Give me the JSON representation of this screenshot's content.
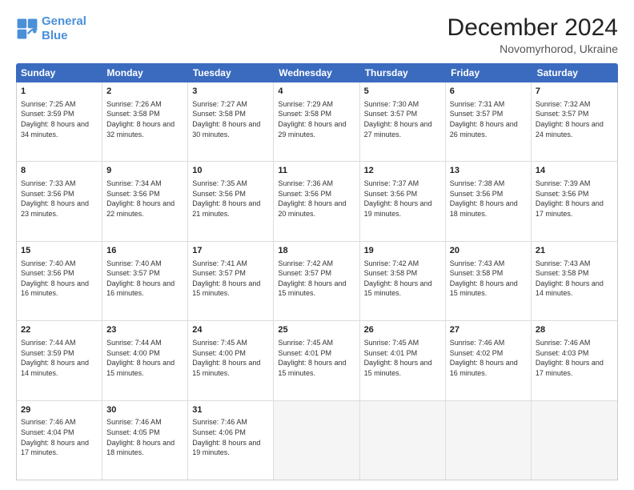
{
  "logo": {
    "line1": "General",
    "line2": "Blue"
  },
  "title": "December 2024",
  "location": "Novomyrhorod, Ukraine",
  "days": [
    "Sunday",
    "Monday",
    "Tuesday",
    "Wednesday",
    "Thursday",
    "Friday",
    "Saturday"
  ],
  "weeks": [
    [
      {
        "day": "1",
        "sunrise": "Sunrise: 7:25 AM",
        "sunset": "Sunset: 3:59 PM",
        "daylight": "Daylight: 8 hours and 34 minutes."
      },
      {
        "day": "2",
        "sunrise": "Sunrise: 7:26 AM",
        "sunset": "Sunset: 3:58 PM",
        "daylight": "Daylight: 8 hours and 32 minutes."
      },
      {
        "day": "3",
        "sunrise": "Sunrise: 7:27 AM",
        "sunset": "Sunset: 3:58 PM",
        "daylight": "Daylight: 8 hours and 30 minutes."
      },
      {
        "day": "4",
        "sunrise": "Sunrise: 7:29 AM",
        "sunset": "Sunset: 3:58 PM",
        "daylight": "Daylight: 8 hours and 29 minutes."
      },
      {
        "day": "5",
        "sunrise": "Sunrise: 7:30 AM",
        "sunset": "Sunset: 3:57 PM",
        "daylight": "Daylight: 8 hours and 27 minutes."
      },
      {
        "day": "6",
        "sunrise": "Sunrise: 7:31 AM",
        "sunset": "Sunset: 3:57 PM",
        "daylight": "Daylight: 8 hours and 26 minutes."
      },
      {
        "day": "7",
        "sunrise": "Sunrise: 7:32 AM",
        "sunset": "Sunset: 3:57 PM",
        "daylight": "Daylight: 8 hours and 24 minutes."
      }
    ],
    [
      {
        "day": "8",
        "sunrise": "Sunrise: 7:33 AM",
        "sunset": "Sunset: 3:56 PM",
        "daylight": "Daylight: 8 hours and 23 minutes."
      },
      {
        "day": "9",
        "sunrise": "Sunrise: 7:34 AM",
        "sunset": "Sunset: 3:56 PM",
        "daylight": "Daylight: 8 hours and 22 minutes."
      },
      {
        "day": "10",
        "sunrise": "Sunrise: 7:35 AM",
        "sunset": "Sunset: 3:56 PM",
        "daylight": "Daylight: 8 hours and 21 minutes."
      },
      {
        "day": "11",
        "sunrise": "Sunrise: 7:36 AM",
        "sunset": "Sunset: 3:56 PM",
        "daylight": "Daylight: 8 hours and 20 minutes."
      },
      {
        "day": "12",
        "sunrise": "Sunrise: 7:37 AM",
        "sunset": "Sunset: 3:56 PM",
        "daylight": "Daylight: 8 hours and 19 minutes."
      },
      {
        "day": "13",
        "sunrise": "Sunrise: 7:38 AM",
        "sunset": "Sunset: 3:56 PM",
        "daylight": "Daylight: 8 hours and 18 minutes."
      },
      {
        "day": "14",
        "sunrise": "Sunrise: 7:39 AM",
        "sunset": "Sunset: 3:56 PM",
        "daylight": "Daylight: 8 hours and 17 minutes."
      }
    ],
    [
      {
        "day": "15",
        "sunrise": "Sunrise: 7:40 AM",
        "sunset": "Sunset: 3:56 PM",
        "daylight": "Daylight: 8 hours and 16 minutes."
      },
      {
        "day": "16",
        "sunrise": "Sunrise: 7:40 AM",
        "sunset": "Sunset: 3:57 PM",
        "daylight": "Daylight: 8 hours and 16 minutes."
      },
      {
        "day": "17",
        "sunrise": "Sunrise: 7:41 AM",
        "sunset": "Sunset: 3:57 PM",
        "daylight": "Daylight: 8 hours and 15 minutes."
      },
      {
        "day": "18",
        "sunrise": "Sunrise: 7:42 AM",
        "sunset": "Sunset: 3:57 PM",
        "daylight": "Daylight: 8 hours and 15 minutes."
      },
      {
        "day": "19",
        "sunrise": "Sunrise: 7:42 AM",
        "sunset": "Sunset: 3:58 PM",
        "daylight": "Daylight: 8 hours and 15 minutes."
      },
      {
        "day": "20",
        "sunrise": "Sunrise: 7:43 AM",
        "sunset": "Sunset: 3:58 PM",
        "daylight": "Daylight: 8 hours and 15 minutes."
      },
      {
        "day": "21",
        "sunrise": "Sunrise: 7:43 AM",
        "sunset": "Sunset: 3:58 PM",
        "daylight": "Daylight: 8 hours and 14 minutes."
      }
    ],
    [
      {
        "day": "22",
        "sunrise": "Sunrise: 7:44 AM",
        "sunset": "Sunset: 3:59 PM",
        "daylight": "Daylight: 8 hours and 14 minutes."
      },
      {
        "day": "23",
        "sunrise": "Sunrise: 7:44 AM",
        "sunset": "Sunset: 4:00 PM",
        "daylight": "Daylight: 8 hours and 15 minutes."
      },
      {
        "day": "24",
        "sunrise": "Sunrise: 7:45 AM",
        "sunset": "Sunset: 4:00 PM",
        "daylight": "Daylight: 8 hours and 15 minutes."
      },
      {
        "day": "25",
        "sunrise": "Sunrise: 7:45 AM",
        "sunset": "Sunset: 4:01 PM",
        "daylight": "Daylight: 8 hours and 15 minutes."
      },
      {
        "day": "26",
        "sunrise": "Sunrise: 7:45 AM",
        "sunset": "Sunset: 4:01 PM",
        "daylight": "Daylight: 8 hours and 15 minutes."
      },
      {
        "day": "27",
        "sunrise": "Sunrise: 7:46 AM",
        "sunset": "Sunset: 4:02 PM",
        "daylight": "Daylight: 8 hours and 16 minutes."
      },
      {
        "day": "28",
        "sunrise": "Sunrise: 7:46 AM",
        "sunset": "Sunset: 4:03 PM",
        "daylight": "Daylight: 8 hours and 17 minutes."
      }
    ],
    [
      {
        "day": "29",
        "sunrise": "Sunrise: 7:46 AM",
        "sunset": "Sunset: 4:04 PM",
        "daylight": "Daylight: 8 hours and 17 minutes."
      },
      {
        "day": "30",
        "sunrise": "Sunrise: 7:46 AM",
        "sunset": "Sunset: 4:05 PM",
        "daylight": "Daylight: 8 hours and 18 minutes."
      },
      {
        "day": "31",
        "sunrise": "Sunrise: 7:46 AM",
        "sunset": "Sunset: 4:06 PM",
        "daylight": "Daylight: 8 hours and 19 minutes."
      },
      null,
      null,
      null,
      null
    ]
  ]
}
